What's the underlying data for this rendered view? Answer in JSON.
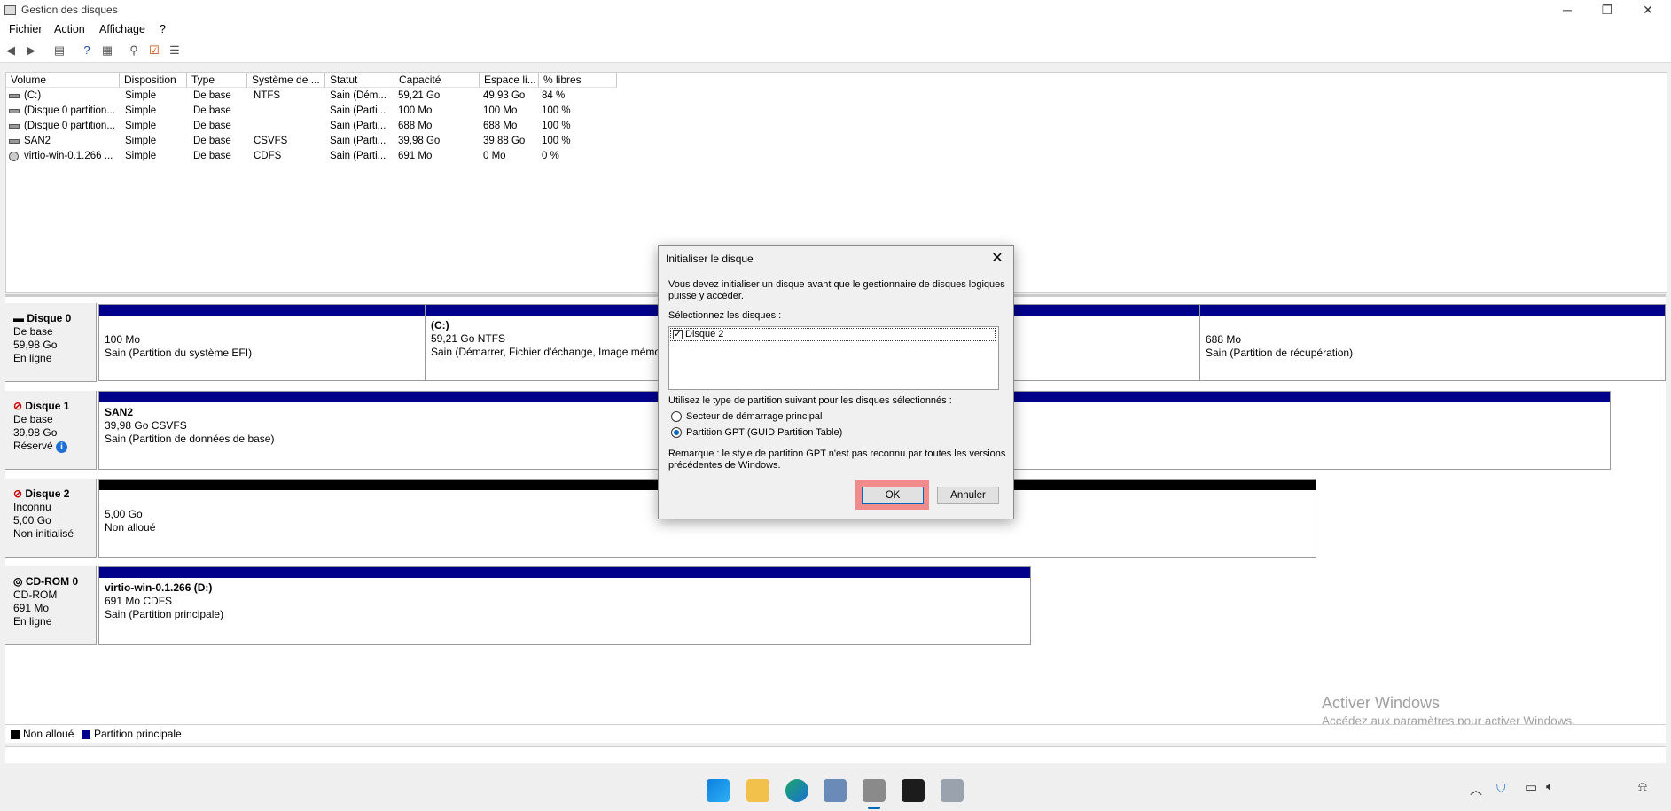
{
  "window": {
    "title": "Gestion des disques"
  },
  "menu": [
    "Fichier",
    "Action",
    "Affichage",
    "?"
  ],
  "volume_table": {
    "columns": [
      "Volume",
      "Disposition",
      "Type",
      "Système de ...",
      "Statut",
      "Capacité",
      "Espace li...",
      "% libres"
    ],
    "rows": [
      [
        "(C:)",
        "Simple",
        "De base",
        "NTFS",
        "Sain (Dém...",
        "59,21 Go",
        "49,93 Go",
        "84 %"
      ],
      [
        "(Disque 0 partition...",
        "Simple",
        "De base",
        "",
        "Sain (Parti...",
        "100 Mo",
        "100 Mo",
        "100 %"
      ],
      [
        "(Disque 0 partition...",
        "Simple",
        "De base",
        "",
        "Sain (Parti...",
        "688 Mo",
        "688 Mo",
        "100 %"
      ],
      [
        "SAN2",
        "Simple",
        "De base",
        "CSVFS",
        "Sain (Parti...",
        "39,98 Go",
        "39,88 Go",
        "100 %"
      ],
      [
        "virtio-win-0.1.266 ...",
        "Simple",
        "De base",
        "CDFS",
        "Sain (Parti...",
        "691 Mo",
        "0 Mo",
        "0 %"
      ]
    ]
  },
  "disks": [
    {
      "name": "Disque 0",
      "type": "De base",
      "size": "59,98 Go",
      "status": "En ligne",
      "partitions": [
        {
          "line1": "100 Mo",
          "line2": "Sain (Partition du système EFI)"
        },
        {
          "title": "(C:)",
          "line1": "59,21 Go NTFS",
          "line2": "Sain (Démarrer, Fichier d'échange, Image mémoire"
        },
        {
          "line1": "688 Mo",
          "line2": "Sain (Partition de récupération)"
        }
      ]
    },
    {
      "name": "Disque 1",
      "type": "De base",
      "size": "39,98 Go",
      "status": "Réservé",
      "partitions": [
        {
          "title": "SAN2",
          "line1": "39,98 Go CSVFS",
          "line2": "Sain (Partition de données de base)"
        }
      ]
    },
    {
      "name": "Disque 2",
      "type": "Inconnu",
      "size": "5,00 Go",
      "status": "Non initialisé",
      "partitions": [
        {
          "line1": "5,00 Go",
          "line2": "Non alloué"
        }
      ]
    },
    {
      "name": "CD-ROM 0",
      "type": "CD-ROM",
      "size": "691 Mo",
      "status": "En ligne",
      "partitions": [
        {
          "title": "virtio-win-0.1.266  (D:)",
          "line1": "691 Mo CDFS",
          "line2": "Sain (Partition principale)"
        }
      ]
    }
  ],
  "legend": [
    {
      "label": "Non alloué",
      "color": "#000000"
    },
    {
      "label": "Partition principale",
      "color": "#00008b"
    }
  ],
  "watermark": {
    "line1": "Activer Windows",
    "line2": "Accédez aux paramètres pour activer Windows."
  },
  "dialog": {
    "title": "Initialiser le disque",
    "intro_line1": "Vous devez initialiser un disque avant que le gestionnaire de disques logiques",
    "intro_line2": "puisse y accéder.",
    "select_label": "Sélectionnez les disques :",
    "disk_item": "Disque 2",
    "partition_label": "Utilisez le type de partition suivant pour les disques sélectionnés :",
    "option_mbr": "Secteur de démarrage principal",
    "option_gpt": "Partition GPT (GUID Partition Table)",
    "note_line1": "Remarque : le style de partition GPT n'est pas reconnu par toutes les versions",
    "note_line2": "précédentes de Windows.",
    "ok": "OK",
    "cancel": "Annuler"
  },
  "colors": {
    "partition": "#00008b",
    "unallocated": "#000000",
    "highlight": "#f28b8b"
  },
  "taskbar_icons": [
    "windows-start-icon",
    "file-explorer-icon",
    "edge-icon",
    "server-manager-icon",
    "disk-management-icon",
    "terminal-icon",
    "settings-icon"
  ]
}
